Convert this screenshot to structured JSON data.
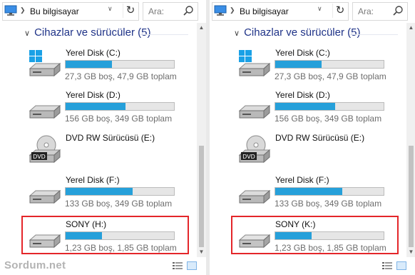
{
  "address_bar": {
    "location": "Bu bilgisayar"
  },
  "search": {
    "placeholder": "Ara:"
  },
  "group": {
    "title": "Cihazlar ve sürücüler (5)"
  },
  "watermark": "Sordum.net",
  "panes": [
    {
      "drives": [
        {
          "name": "Yerel Disk (C:)",
          "info": "27,3 GB boş, 47,9 GB toplam",
          "used_fraction": 0.43,
          "icon": "windows-drive-icon"
        },
        {
          "name": "Yerel Disk (D:)",
          "info": "156 GB boş, 349 GB toplam",
          "used_fraction": 0.55,
          "icon": "hard-drive-icon"
        },
        {
          "name": "DVD RW Sürücüsü (E:)",
          "info": "",
          "icon": "dvd-drive-icon",
          "badge": "DVD"
        },
        {
          "name": "Yerel Disk (F:)",
          "info": "133 GB boş, 349 GB toplam",
          "used_fraction": 0.62,
          "icon": "hard-drive-icon"
        },
        {
          "name": "SONY (H:)",
          "info": "1,23 GB boş, 1,85 GB toplam",
          "used_fraction": 0.335,
          "icon": "usb-drive-icon"
        }
      ]
    },
    {
      "drives": [
        {
          "name": "Yerel Disk (C:)",
          "info": "27,3 GB boş, 47,9 GB toplam",
          "used_fraction": 0.43,
          "icon": "windows-drive-icon"
        },
        {
          "name": "Yerel Disk (D:)",
          "info": "156 GB boş, 349 GB toplam",
          "used_fraction": 0.55,
          "icon": "hard-drive-icon"
        },
        {
          "name": "DVD RW Sürücüsü (E:)",
          "info": "",
          "icon": "dvd-drive-icon",
          "badge": "DVD"
        },
        {
          "name": "Yerel Disk (F:)",
          "info": "133 GB boş, 349 GB toplam",
          "used_fraction": 0.62,
          "icon": "hard-drive-icon"
        },
        {
          "name": "SONY (K:)",
          "info": "1,23 GB boş, 1,85 GB toplam",
          "used_fraction": 0.335,
          "icon": "usb-drive-icon"
        }
      ]
    }
  ],
  "colors": {
    "bar_fill": "#26a0da",
    "bar_track": "#e6e6e6",
    "highlight": "#e4262a",
    "group_header": "#1e3287"
  }
}
